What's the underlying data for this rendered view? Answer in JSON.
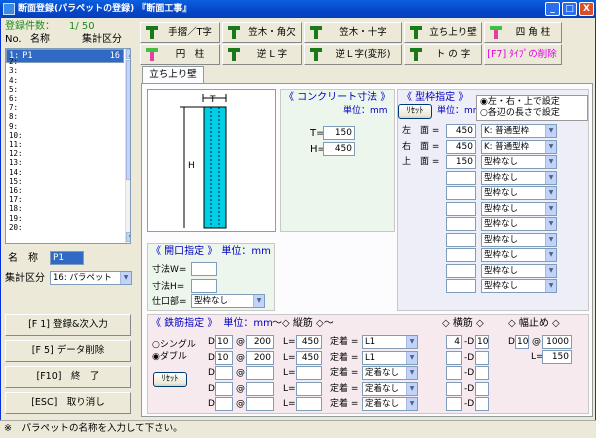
{
  "title": "断面登録(パラペットの登録) 『断面工事』",
  "window_buttons": {
    "minimize": "_",
    "maximize": "□",
    "close": "X"
  },
  "left": {
    "count_label": "登録件数：",
    "count_value": "1/ 50",
    "col_no": "No.",
    "col_name": "名称",
    "col_category": "集計区分",
    "rows": [
      {
        "no": "1:",
        "name": "P1",
        "cat": "16"
      },
      {
        "no": "2:"
      },
      {
        "no": "3:"
      },
      {
        "no": "4:"
      },
      {
        "no": "5:"
      },
      {
        "no": "6:"
      },
      {
        "no": "7:"
      },
      {
        "no": "8:"
      },
      {
        "no": "9:"
      },
      {
        "no": "10:"
      },
      {
        "no": "11:"
      },
      {
        "no": "12:"
      },
      {
        "no": "13:"
      },
      {
        "no": "14:"
      },
      {
        "no": "15:"
      },
      {
        "no": "16:"
      },
      {
        "no": "17:"
      },
      {
        "no": "18:"
      },
      {
        "no": "19:"
      },
      {
        "no": "20:"
      }
    ],
    "name_label": "名　称",
    "name_value": "P1",
    "category_label": "集計区分",
    "category_value": "16: パラペット",
    "buttons": {
      "register": "[F 1] 登録&次入力",
      "delete": "[F 5] データ削除",
      "end": "[F10]　終　了",
      "cancel": "[ESC]　取り消し"
    }
  },
  "toolbar": {
    "row1": [
      "手摺／T字",
      "笠木・角欠",
      "笠木・十字",
      "立ち上り壁",
      "四 角 柱"
    ],
    "row2": [
      "円　柱",
      "逆 L 字",
      "逆Ｌ字(変形)",
      "ト の 字",
      "[F7] ﾀｲﾌﾟの削除"
    ]
  },
  "tab": "立ち上り壁",
  "concrete": {
    "heading": "《 コンクリート寸法 》",
    "unit": "単位：mm",
    "t_label": "T=",
    "t_value": "150",
    "h_label": "H=",
    "h_value": "450"
  },
  "diagram": {
    "t": "T",
    "h": "H"
  },
  "frame": {
    "heading": "《 型枠指定 》",
    "reset": "ﾘｾｯﾄ",
    "unit": "単位：mm",
    "radio1": "左・右・上で設定",
    "radio2": "各辺の長さで設定",
    "rows": [
      {
        "label": "左　面 =",
        "value": "450",
        "type": "K: 普通型枠"
      },
      {
        "label": "右　面 =",
        "value": "450",
        "type": "K: 普通型枠"
      },
      {
        "label": "上　面 =",
        "value": "150",
        "type": "型枠なし"
      },
      {
        "label": "",
        "value": "",
        "type": "型枠なし"
      },
      {
        "label": "",
        "value": "",
        "type": "型枠なし"
      },
      {
        "label": "",
        "value": "",
        "type": "型枠なし"
      },
      {
        "label": "",
        "value": "",
        "type": "型枠なし"
      },
      {
        "label": "",
        "value": "",
        "type": "型枠なし"
      },
      {
        "label": "",
        "value": "",
        "type": "型枠なし"
      },
      {
        "label": "",
        "value": "",
        "type": "型枠なし"
      },
      {
        "label": "",
        "value": "",
        "type": "型枠なし"
      }
    ]
  },
  "opening": {
    "heading": "《 開口指定 》",
    "unit": "単位：mm",
    "w_label": "寸法W=",
    "h_label": "寸法H=",
    "finish_label": "仕口部=",
    "finish_value": "型枠なし"
  },
  "rebar": {
    "heading": "《 鉄筋指定 》",
    "unit": "単位：mm",
    "vertical": "〜◇ 縦筋 ◇〜",
    "horizontal": "◇ 横筋 ◇",
    "width_stop": "◇ 幅止め ◇",
    "single": "シングル",
    "double": "ダブル",
    "reset": "ﾘｾｯﾄ",
    "rows": [
      {
        "d": "10",
        "pitch": "200",
        "len": "450",
        "fix": "L1"
      },
      {
        "d": "10",
        "pitch": "200",
        "len": "450",
        "fix": "L1"
      },
      {
        "d": "",
        "pitch": "",
        "len": "",
        "fix": "定着なし"
      },
      {
        "d": "",
        "pitch": "",
        "len": "",
        "fix": "定着なし"
      },
      {
        "d": "",
        "pitch": "",
        "len": "",
        "fix": "定着なし"
      }
    ],
    "h_rows": [
      {
        "n": "4",
        "d": "10"
      },
      {
        "n": "",
        "d": ""
      },
      {
        "n": "",
        "d": ""
      },
      {
        "n": "",
        "d": ""
      },
      {
        "n": "",
        "d": ""
      }
    ],
    "d_label": "D",
    "at": "@",
    "l_label": "L=",
    "fix_label": "定着 =",
    "dash_d": "-D",
    "ws_d": "10",
    "ws_pitch": "1000",
    "ws_l": "150"
  },
  "status": "※　パラペットの名称を入力して下さい。"
}
